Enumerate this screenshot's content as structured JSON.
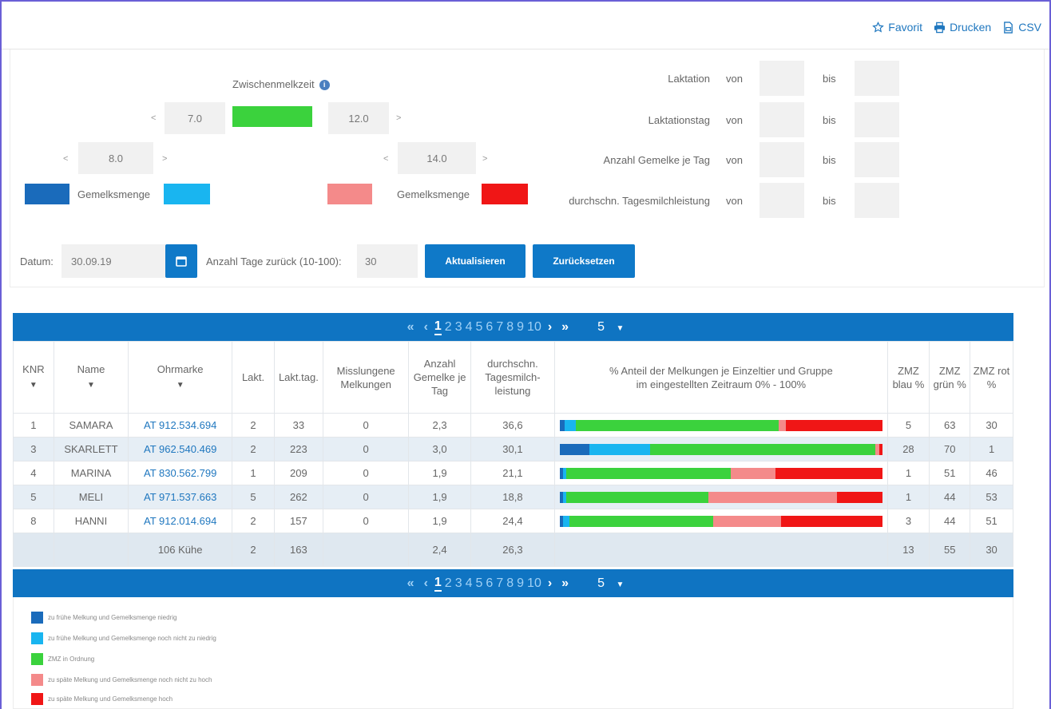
{
  "colors": {
    "dark_blue": "#1a6bbb",
    "light_blue": "#19b5f0",
    "green": "#3bd23d",
    "pink": "#f48a8a",
    "red": "#f01616",
    "primary": "#0f79c8"
  },
  "toolbar": {
    "favorit": "Favorit",
    "drucken": "Drucken",
    "csv": "CSV"
  },
  "filters": {
    "zmz_label": "Zwischenmelkzeit",
    "zmz_low": "7.0",
    "zmz_high": "12.0",
    "gem_low_value": "8.0",
    "gem_high_value": "14.0",
    "gemelksmenge_left": "Gemelksmenge",
    "gemelksmenge_right": "Gemelksmenge",
    "arrow_left": "<",
    "arrow_right": ">",
    "right": {
      "rows": [
        {
          "label": "Laktation",
          "von": "von",
          "bis": "bis"
        },
        {
          "label": "Laktationstag",
          "von": "von",
          "bis": "bis"
        },
        {
          "label": "Anzahl Gemelke je Tag",
          "von": "von",
          "bis": "bis"
        },
        {
          "label": "durchschn. Tagesmilchleistung",
          "von": "von",
          "bis": "bis"
        }
      ]
    },
    "datum_label": "Datum:",
    "datum_value": "30.09.19",
    "tage_label": "Anzahl Tage zurück (10-100):",
    "tage_value": "30",
    "aktualisieren": "Aktualisieren",
    "zuruecksetzen": "Zurücksetzen"
  },
  "pager": {
    "first": "«",
    "prev": "‹",
    "pages": [
      "1",
      "2",
      "3",
      "4",
      "5",
      "6",
      "7",
      "8",
      "9",
      "10"
    ],
    "current": "1",
    "next": "›",
    "last": "»",
    "page_size": "5"
  },
  "table": {
    "headers": {
      "knr": "KNR",
      "name": "Name",
      "ohrmarke": "Ohrmarke",
      "lakt": "Lakt.",
      "lakttag": "Lakt.tag.",
      "misslungene": "Misslungene Melkungen",
      "anzahl": "Anzahl Gemelke je Tag",
      "durchschn": "durchschn. Tagesmilch-leistung",
      "anteil": "% Anteil der Melkungen je Einzeltier und Gruppe im eingestellten Zeitraum 0% - 100%",
      "zmz_blau": "ZMZ blau %",
      "zmz_gruen": "ZMZ grün %",
      "zmz_rot": "ZMZ rot %"
    },
    "rows": [
      {
        "knr": "1",
        "name": "SAMARA",
        "ohrmarke": "AT 912.534.694",
        "lakt": "2",
        "lakttag": "33",
        "miss": "0",
        "anzahl": "2,3",
        "milch": "36,6",
        "bar": [
          1.5,
          3.5,
          63,
          2,
          30
        ],
        "blau": "5",
        "gruen": "63",
        "rot": "30"
      },
      {
        "knr": "3",
        "name": "SKARLETT",
        "ohrmarke": "AT 962.540.469",
        "lakt": "2",
        "lakttag": "223",
        "miss": "0",
        "anzahl": "3,0",
        "milch": "30,1",
        "bar": [
          9,
          19,
          70,
          1,
          1
        ],
        "blau": "28",
        "gruen": "70",
        "rot": "1"
      },
      {
        "knr": "4",
        "name": "MARINA",
        "ohrmarke": "AT 830.562.799",
        "lakt": "1",
        "lakttag": "209",
        "miss": "0",
        "anzahl": "1,9",
        "milch": "21,1",
        "bar": [
          1,
          1,
          51,
          14,
          33
        ],
        "blau": "1",
        "gruen": "51",
        "rot": "46"
      },
      {
        "knr": "5",
        "name": "MELI",
        "ohrmarke": "AT 971.537.663",
        "lakt": "5",
        "lakttag": "262",
        "miss": "0",
        "anzahl": "1,9",
        "milch": "18,8",
        "bar": [
          1,
          1,
          44,
          40,
          14
        ],
        "blau": "1",
        "gruen": "44",
        "rot": "53"
      },
      {
        "knr": "8",
        "name": "HANNI",
        "ohrmarke": "AT 912.014.694",
        "lakt": "2",
        "lakttag": "157",
        "miss": "0",
        "anzahl": "1,9",
        "milch": "24,4",
        "bar": [
          1,
          2,
          44,
          21,
          31
        ],
        "blau": "3",
        "gruen": "44",
        "rot": "51"
      }
    ],
    "summary": {
      "name": "106 Kühe",
      "lakt": "2",
      "lakttag": "163",
      "anzahl": "2,4",
      "milch": "26,3",
      "blau": "13",
      "gruen": "55",
      "rot": "30"
    }
  },
  "legend": [
    {
      "label": "zu frühe Melkung und Gemelksmenge niedrig",
      "color": "#1a6bbb"
    },
    {
      "label": "zu frühe Melkung und Gemelksmenge noch nicht zu niedrig",
      "color": "#19b5f0"
    },
    {
      "label": "ZMZ in Ordnung",
      "color": "#3bd23d"
    },
    {
      "label": "zu späte Melkung und Gemelksmenge noch nicht zu hoch",
      "color": "#f48a8a"
    },
    {
      "label": "zu späte Melkung und Gemelksmenge hoch",
      "color": "#f01616"
    }
  ]
}
